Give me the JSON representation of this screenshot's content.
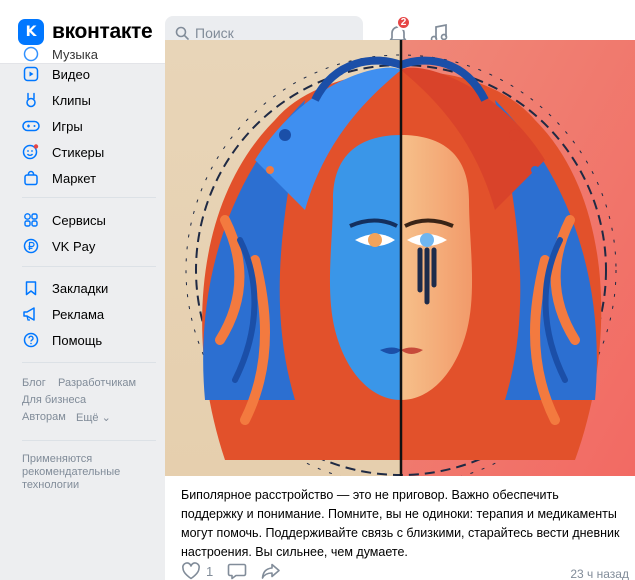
{
  "header": {
    "logo_text": "вконтакте",
    "search_placeholder": "Поиск",
    "notifications_count": "2"
  },
  "sidebar": {
    "partial_item": "Музыка",
    "items": [
      {
        "label": "Видео",
        "icon": "video-icon"
      },
      {
        "label": "Клипы",
        "icon": "clips-icon"
      },
      {
        "label": "Игры",
        "icon": "games-icon"
      },
      {
        "label": "Стикеры",
        "icon": "stickers-icon"
      },
      {
        "label": "Маркет",
        "icon": "market-icon"
      },
      {
        "label": "Сервисы",
        "icon": "services-icon"
      },
      {
        "label": "VK Pay",
        "icon": "vkpay-icon"
      },
      {
        "label": "Закладки",
        "icon": "bookmarks-icon"
      },
      {
        "label": "Реклама",
        "icon": "ads-icon"
      },
      {
        "label": "Помощь",
        "icon": "help-icon"
      }
    ],
    "footer": {
      "blog": "Блог",
      "developers": "Разработчикам",
      "business": "Для бизнеса",
      "authors": "Авторам",
      "more": "Ещё"
    },
    "recommendation_note": "Применяются рекомендательные технологии"
  },
  "post": {
    "text": "Биполярное расстройство — это не приговор. Важно обеспечить поддержку и понимание. Помните, вы не одиноки: терапия и медикаменты могут помочь. Поддерживайте связь с близкими, старайтесь вести дневник настроения. Вы сильнее, чем думаете.",
    "likes": "1",
    "time": "23 ч назад"
  },
  "colors": {
    "accent": "#0077ff",
    "badge": "#e64646",
    "muted": "#818c99"
  }
}
